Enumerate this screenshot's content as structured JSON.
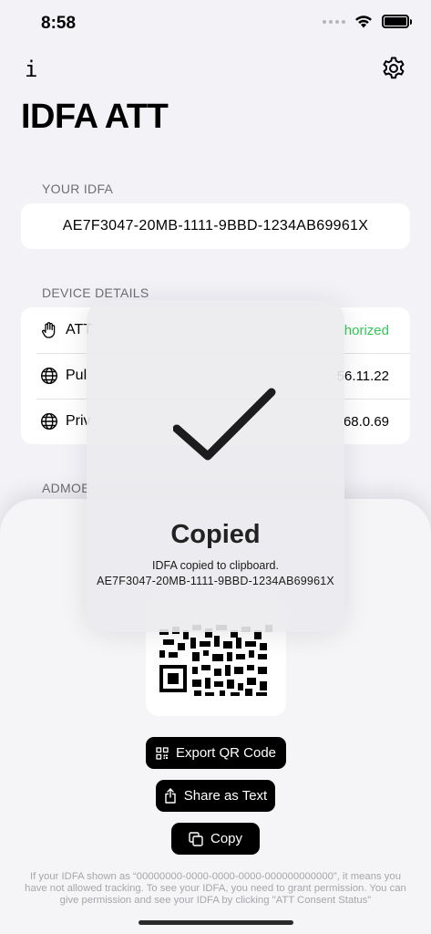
{
  "status_bar": {
    "time": "8:58"
  },
  "nav": {
    "info_label": "i",
    "title": "IDFA ATT"
  },
  "your_idfa": {
    "section_label": "YOUR IDFA",
    "value": "AE7F3047-20MB-1111-9BBD-1234AB69961X"
  },
  "device_details": {
    "section_label": "DEVICE DETAILS",
    "rows": [
      {
        "icon": "hand-icon",
        "label": "ATT",
        "value": "horized",
        "value_color": "#34c759"
      },
      {
        "icon": "globe-icon",
        "label": "Pul",
        "value": "56.11.22"
      },
      {
        "icon": "globe-icon",
        "label": "Priv",
        "value": "68.0.69"
      }
    ]
  },
  "admob": {
    "section_label": "ADMOE"
  },
  "sheet": {
    "buttons": {
      "export": "Export QR Code",
      "share": "Share as Text",
      "copy": "Copy"
    },
    "footnote": "If your IDFA shown as “00000000-0000-0000-0000-000000000000”, it means you have not allowed tracking. To see your IDFA, you need to grant permission. You can give permission and see your IDFA by clicking \"ATT Consent Status\""
  },
  "hud": {
    "title": "Copied",
    "message": "IDFA copied to clipboard.",
    "idfa": "AE7F3047-20MB-1111-9BBD-1234AB69961X"
  },
  "colors": {
    "accent_green": "#34c759",
    "button_black": "#000000"
  }
}
